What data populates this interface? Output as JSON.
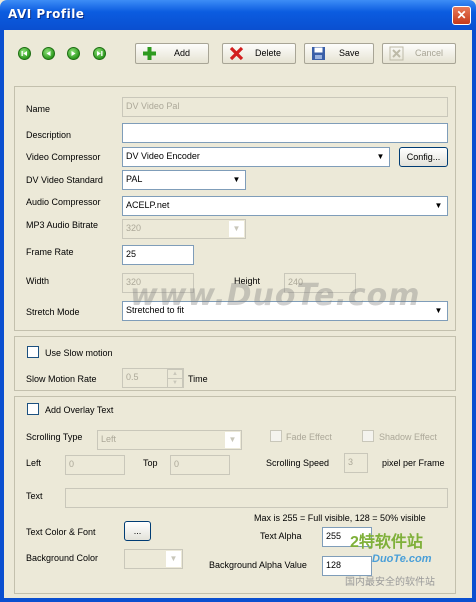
{
  "window": {
    "title": "AVI Profile",
    "close_glyph": "✕"
  },
  "toolbar": {
    "nav_icons": [
      "first-icon",
      "prev-icon",
      "next-icon",
      "last-icon"
    ],
    "add": "Add",
    "delete": "Delete",
    "save": "Save",
    "cancel": "Cancel"
  },
  "form": {
    "name_label": "Name",
    "name_value": "DV Video Pal",
    "description_label": "Description",
    "description_value": "",
    "video_compressor_label": "Video Compressor",
    "video_compressor_value": "DV Video Encoder",
    "config_button": "Config...",
    "dv_standard_label": "DV Video Standard",
    "dv_standard_value": "PAL",
    "audio_compressor_label": "Audio Compressor",
    "audio_compressor_value": "ACELP.net",
    "mp3_bitrate_label": "MP3 Audio Bitrate",
    "mp3_bitrate_value": "320",
    "frame_rate_label": "Frame Rate",
    "frame_rate_value": "25",
    "width_label": "Width",
    "width_value": "320",
    "height_label": "Height",
    "height_value": "240",
    "stretch_label": "Stretch Mode",
    "stretch_value": "Stretched to fit"
  },
  "slow_motion": {
    "checkbox_label": "Use Slow motion",
    "rate_label": "Slow Motion Rate",
    "rate_value": "0.5",
    "unit": "Time"
  },
  "overlay": {
    "checkbox_label": "Add Overlay Text",
    "scrolling_type_label": "Scrolling Type",
    "scrolling_type_value": "Left",
    "fade_label": "Fade Effect",
    "shadow_label": "Shadow Effect",
    "left_label": "Left",
    "left_value": "0",
    "top_label": "Top",
    "top_value": "0",
    "speed_label": "Scrolling Speed",
    "speed_value": "3",
    "speed_unit": "pixel per Frame",
    "text_label": "Text",
    "text_value": "",
    "alpha_note": "Max is 255 = Full visible, 128 = 50% visible",
    "color_font_label": "Text Color & Font",
    "color_font_button": "...",
    "text_alpha_label": "Text Alpha",
    "text_alpha_value": "255",
    "bg_color_label": "Background Color",
    "bg_alpha_label": "Background Alpha Value",
    "bg_alpha_value": "128"
  },
  "watermark": {
    "main": "www.DuoTe.com",
    "logo_cn": "2特软件站",
    "logo_en": "DuoTe.com",
    "logo_sub": "国内最安全的软件站"
  },
  "colors": {
    "title_bar": "#0a4fd0",
    "nav_green": "#2e9a1f",
    "dialog_bg": "#ece9d8"
  }
}
